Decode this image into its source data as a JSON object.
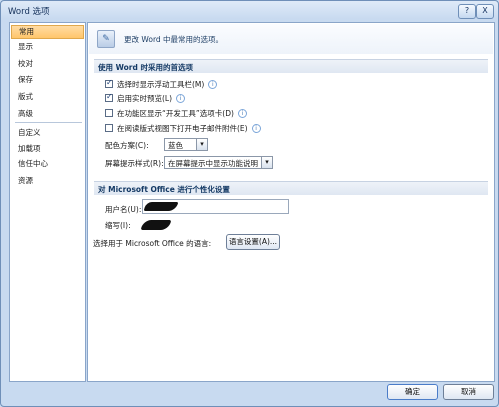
{
  "window": {
    "title": "Word 选项",
    "help_icon": "?",
    "close_icon": "X"
  },
  "sidebar": {
    "items": [
      {
        "label": "常用"
      },
      {
        "label": "显示"
      },
      {
        "label": "校对"
      },
      {
        "label": "保存"
      },
      {
        "label": "版式"
      },
      {
        "label": "高级"
      },
      {
        "label": "自定义"
      },
      {
        "label": "加载项"
      },
      {
        "label": "信任中心"
      },
      {
        "label": "资源"
      }
    ]
  },
  "main": {
    "header_text": "更改 Word 中最常用的选项。",
    "section1": {
      "title": "使用 Word 时采用的首选项",
      "options": [
        {
          "label": "选择时显示浮动工具栏(M)",
          "checked": true
        },
        {
          "label": "启用实时预览(L)",
          "checked": true
        },
        {
          "label": "在功能区显示“开发工具”选项卡(D)",
          "checked": false
        },
        {
          "label": "在阅读版式视图下打开电子邮件附件(E)",
          "checked": false
        }
      ],
      "color_scheme_label": "配色方案(C):",
      "color_scheme_value": "蓝色",
      "screen_tip_label": "屏幕提示样式(R):",
      "screen_tip_value": "在屏幕提示中显示功能说明"
    },
    "section2": {
      "title": "对 Microsoft Office 进行个性化设置",
      "username_label": "用户名(U):",
      "initials_label": "缩写(I):",
      "language_label": "选择用于 Microsoft Office 的语言:",
      "language_button": "语言设置(A)..."
    }
  },
  "footer": {
    "ok": "确定",
    "cancel": "取消"
  },
  "icons": {
    "info": "i",
    "dropdown": "▾",
    "header": "✎"
  }
}
